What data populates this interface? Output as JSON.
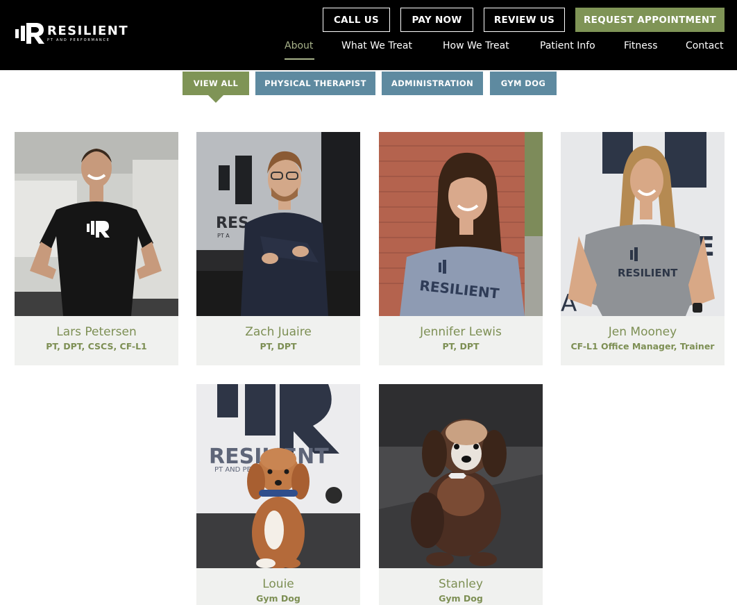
{
  "brand": {
    "name": "RESILIENT",
    "tagline": "PT AND PERFORMANCE"
  },
  "header_buttons": [
    {
      "label": "CALL US"
    },
    {
      "label": "PAY NOW"
    },
    {
      "label": "REVIEW US"
    },
    {
      "label": "REQUEST APPOINTMENT"
    }
  ],
  "nav": [
    {
      "label": "About",
      "active": true
    },
    {
      "label": "What We Treat"
    },
    {
      "label": "How We Treat"
    },
    {
      "label": "Patient Info"
    },
    {
      "label": "Fitness"
    },
    {
      "label": "Contact"
    }
  ],
  "filters": [
    {
      "label": "VIEW ALL",
      "active": true
    },
    {
      "label": "PHYSICAL THERAPIST"
    },
    {
      "label": "ADMINISTRATION"
    },
    {
      "label": "GYM DOG"
    }
  ],
  "team": [
    {
      "name": "Lars Petersen",
      "role": "PT, DPT, CSCS, CF-L1"
    },
    {
      "name": "Zach Juaire",
      "role": "PT, DPT"
    },
    {
      "name": "Jennifer Lewis",
      "role": "PT, DPT"
    },
    {
      "name": "Jen Mooney",
      "role": "CF-L1  Office Manager, Trainer"
    },
    {
      "name": "Louie",
      "role": "Gym Dog"
    },
    {
      "name": "Stanley",
      "role": "Gym Dog"
    }
  ],
  "colors": {
    "accent_green": "#7f9456",
    "filter_blue": "#5e8aa0",
    "header_bg": "#000000",
    "caption_bg": "#f0f1ef"
  }
}
